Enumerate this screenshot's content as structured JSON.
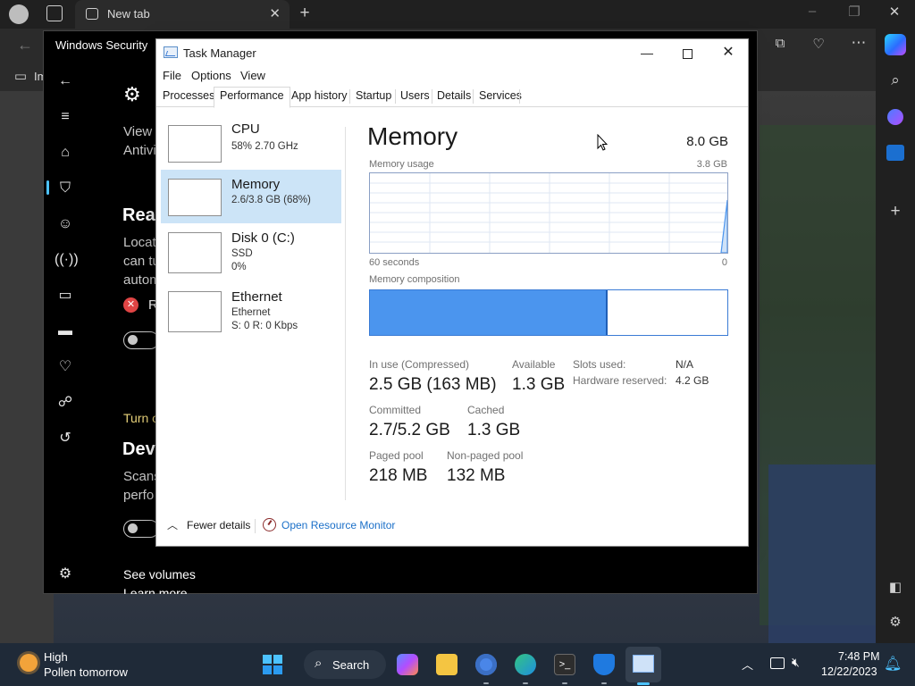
{
  "browser": {
    "tab_title": "New tab",
    "favorites_fragment": "Im"
  },
  "security": {
    "title": "Windows Security",
    "view_line1": "View a",
    "view_line2": "Antivi",
    "heading_realtime": "Real",
    "desc_line1": "Locat",
    "desc_line2": "can tu",
    "desc_line3": "autom",
    "status_fragment": "R",
    "turn_link": "Turn o",
    "heading_dev": "Dev",
    "dev_line1": "Scans",
    "dev_line2": "perfo",
    "see_volumes": "See volumes",
    "learn_more": "Learn more"
  },
  "taskmgr": {
    "title": "Task Manager",
    "menus": [
      "File",
      "Options",
      "View"
    ],
    "tabs": [
      "Processes",
      "Performance",
      "App history",
      "Startup",
      "Users",
      "Details",
      "Services"
    ],
    "resources": [
      {
        "name": "CPU",
        "line1": "58%  2.70 GHz",
        "line2": ""
      },
      {
        "name": "Memory",
        "line1": "2.6/3.8 GB (68%)",
        "line2": ""
      },
      {
        "name": "Disk 0 (C:)",
        "line1": "SSD",
        "line2": "0%"
      },
      {
        "name": "Ethernet",
        "line1": "Ethernet",
        "line2": "S: 0  R: 0 Kbps"
      }
    ],
    "memory": {
      "title": "Memory",
      "total": "8.0 GB",
      "usage_label": "Memory usage",
      "usage_max": "3.8 GB",
      "time_left": "60 seconds",
      "time_right": "0",
      "composition_label": "Memory composition",
      "in_use_fraction": 0.66,
      "in_use_label": "In use (Compressed)",
      "in_use_value": "2.5 GB (163 MB)",
      "available_label": "Available",
      "available_value": "1.3 GB",
      "committed_label": "Committed",
      "committed_value": "2.7/5.2 GB",
      "cached_label": "Cached",
      "cached_value": "1.3 GB",
      "paged_label": "Paged pool",
      "paged_value": "218 MB",
      "nonpaged_label": "Non-paged pool",
      "nonpaged_value": "132 MB",
      "slots_label": "Slots used:",
      "slots_value": "N/A",
      "hwres_label": "Hardware reserved:",
      "hwres_value": "4.2 GB"
    },
    "fewer_details": "Fewer details",
    "open_resource_monitor": "Open Resource Monitor"
  },
  "taskbar": {
    "weather_title": "High",
    "weather_sub": "Pollen tomorrow",
    "search": "Search",
    "time": "7:48 PM",
    "date": "12/22/2023"
  },
  "colors": {
    "accent": "#4b95ee",
    "selected_row": "#cce4f7",
    "link": "#1a6fc8"
  }
}
